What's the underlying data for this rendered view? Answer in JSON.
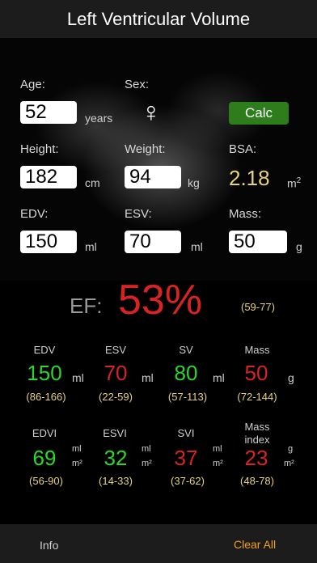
{
  "title": "Left Ventricular Volume",
  "inputs": {
    "age": {
      "label": "Age:",
      "value": "52",
      "unit": "years"
    },
    "sex": {
      "label": "Sex:",
      "symbol": "♀"
    },
    "calc_label": "Calc",
    "height": {
      "label": "Height:",
      "value": "182",
      "unit": "cm"
    },
    "weight": {
      "label": "Weight:",
      "value": "94",
      "unit": "kg"
    },
    "bsa": {
      "label": "BSA:",
      "value": "2.18",
      "unit": "m",
      "unit_sup": "2"
    },
    "edv": {
      "label": "EDV:",
      "value": "150",
      "unit": "ml"
    },
    "esv": {
      "label": "ESV:",
      "value": "70",
      "unit": "ml"
    },
    "mass": {
      "label": "Mass:",
      "value": "50",
      "unit": "g"
    }
  },
  "ef": {
    "label": "EF:",
    "value": "53%",
    "range": "(59-77)"
  },
  "results_row1": [
    {
      "header": "EDV",
      "value": "150",
      "unit": "ml",
      "range": "(86-166)"
    },
    {
      "header": "ESV",
      "value": "70",
      "unit": "ml",
      "range": "(22-59)"
    },
    {
      "header": "SV",
      "value": "80",
      "unit": "ml",
      "range": "(57-113)"
    },
    {
      "header": "Mass",
      "value": "50",
      "unit": "g",
      "range": "(72-144)"
    }
  ],
  "results_row2": [
    {
      "header": "EDVI",
      "value": "69",
      "unit_top": "ml",
      "unit_bottom": "m²",
      "range": "(56-90)"
    },
    {
      "header": "ESVI",
      "value": "32",
      "unit_top": "ml",
      "unit_bottom": "m²",
      "range": "(14-33)"
    },
    {
      "header": "SVI",
      "value": "37",
      "unit_top": "ml",
      "unit_bottom": "m²",
      "range": "(37-62)"
    },
    {
      "header_line1": "Mass",
      "header_line2": "index",
      "value": "23",
      "unit_top": "g",
      "unit_bottom": "m²",
      "range": "(48-78)"
    }
  ],
  "bottom": {
    "info": "Info",
    "clear": "Clear All"
  },
  "colors": {
    "normal": "#2bd62b",
    "abnormal": "#d82323",
    "range": "#e7d27a",
    "calc_button": "#2e7d1c",
    "clear_all": "#f0a020"
  }
}
